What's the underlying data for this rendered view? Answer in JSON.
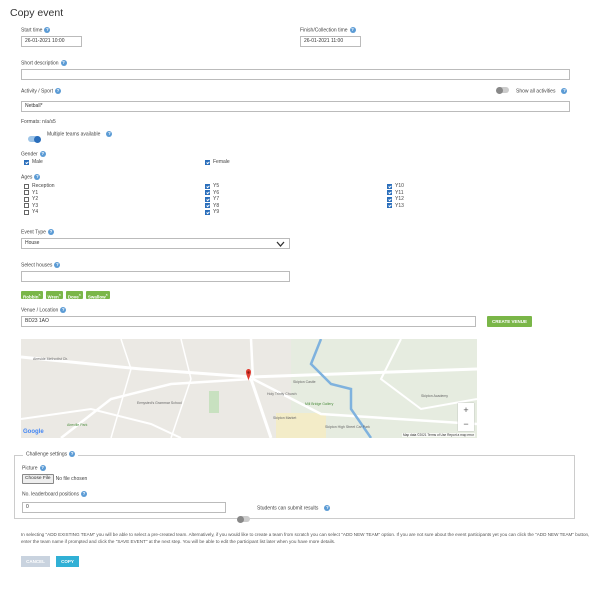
{
  "page": {
    "title": "Copy event"
  },
  "times": {
    "start_label": "Start time",
    "start_value": "26-01-2021 10:00",
    "finish_label": "Finish/Collection time",
    "finish_value": "26-01-2021 11:00"
  },
  "short_description": {
    "label": "Short description",
    "value": ""
  },
  "activity": {
    "label": "Activity / Sport",
    "value": "Netball*",
    "show_all_label": "Show all activities",
    "show_all_on": false
  },
  "formats": {
    "label": "Formats: n/a/s5",
    "multiple_teams_label": "Multiple teams available",
    "multiple_teams_on": true
  },
  "gender": {
    "label": "Gender",
    "options": [
      {
        "label": "Male",
        "checked": true
      },
      {
        "label": "Female",
        "checked": true
      }
    ]
  },
  "ages": {
    "label": "Ages",
    "columns": [
      [
        {
          "label": "Reception",
          "checked": false
        },
        {
          "label": "Y1",
          "checked": false
        },
        {
          "label": "Y2",
          "checked": false
        },
        {
          "label": "Y3",
          "checked": false
        },
        {
          "label": "Y4",
          "checked": false
        }
      ],
      [
        {
          "label": "Y5",
          "checked": true
        },
        {
          "label": "Y6",
          "checked": true
        },
        {
          "label": "Y7",
          "checked": true
        },
        {
          "label": "Y8",
          "checked": true
        },
        {
          "label": "Y9",
          "checked": true
        }
      ],
      [
        {
          "label": "Y10",
          "checked": true
        },
        {
          "label": "Y11",
          "checked": true
        },
        {
          "label": "Y12",
          "checked": true
        },
        {
          "label": "Y13",
          "checked": true
        }
      ]
    ]
  },
  "event_type": {
    "label": "Event Type",
    "value": "House"
  },
  "houses": {
    "label": "Select houses",
    "value": "",
    "chips": [
      "Robbin",
      "Wren",
      "Dove",
      "Swallow"
    ]
  },
  "venue": {
    "label": "Venue / Location",
    "value": "BD23 1AO",
    "create_button": "CREATE VENUE"
  },
  "map": {
    "google_label": "Google",
    "attribution": "Map data ©2021   Terms of Use   Report a map error",
    "zoom_in": "+",
    "zoom_out": "−",
    "places": [
      "Aireside Methodist Ch.",
      "Skipton Castle",
      "Holy Trinity Church",
      "Ermysted's Grammar School",
      "Mill Bridge Gallery",
      "Skipton Market",
      "Skipton High Street Car Park",
      "Aireville Park",
      "Skipton Academy"
    ]
  },
  "challenge": {
    "legend": "Challenge settings",
    "picture_label": "Picture",
    "choose_file": "Choose File",
    "no_file": "No file chosen",
    "leaderboard_label": "No. leaderboard positions",
    "leaderboard_value": "0",
    "students_submit_label": "Students can submit results",
    "students_submit_on": false
  },
  "note": "In selecting \"ADD EXISTING TEAM\" you will be able to select a pre-created team. Alternatively, if you would like to create a team from scratch you can select \"ADD NEW TEAM\" option. If you are not sure about the event participants yet you can click the \"ADD NEW TEAM\" button, enter the team name if prompted and click the \"SAVE EVENT\" at the next step. You will be able to edit the participant list later when you have more details.",
  "actions": {
    "cancel": "CANCEL",
    "copy": "COPY"
  },
  "colors": {
    "accent": "#31b0d5",
    "green": "#7ab648",
    "help": "#5b9bd5"
  }
}
